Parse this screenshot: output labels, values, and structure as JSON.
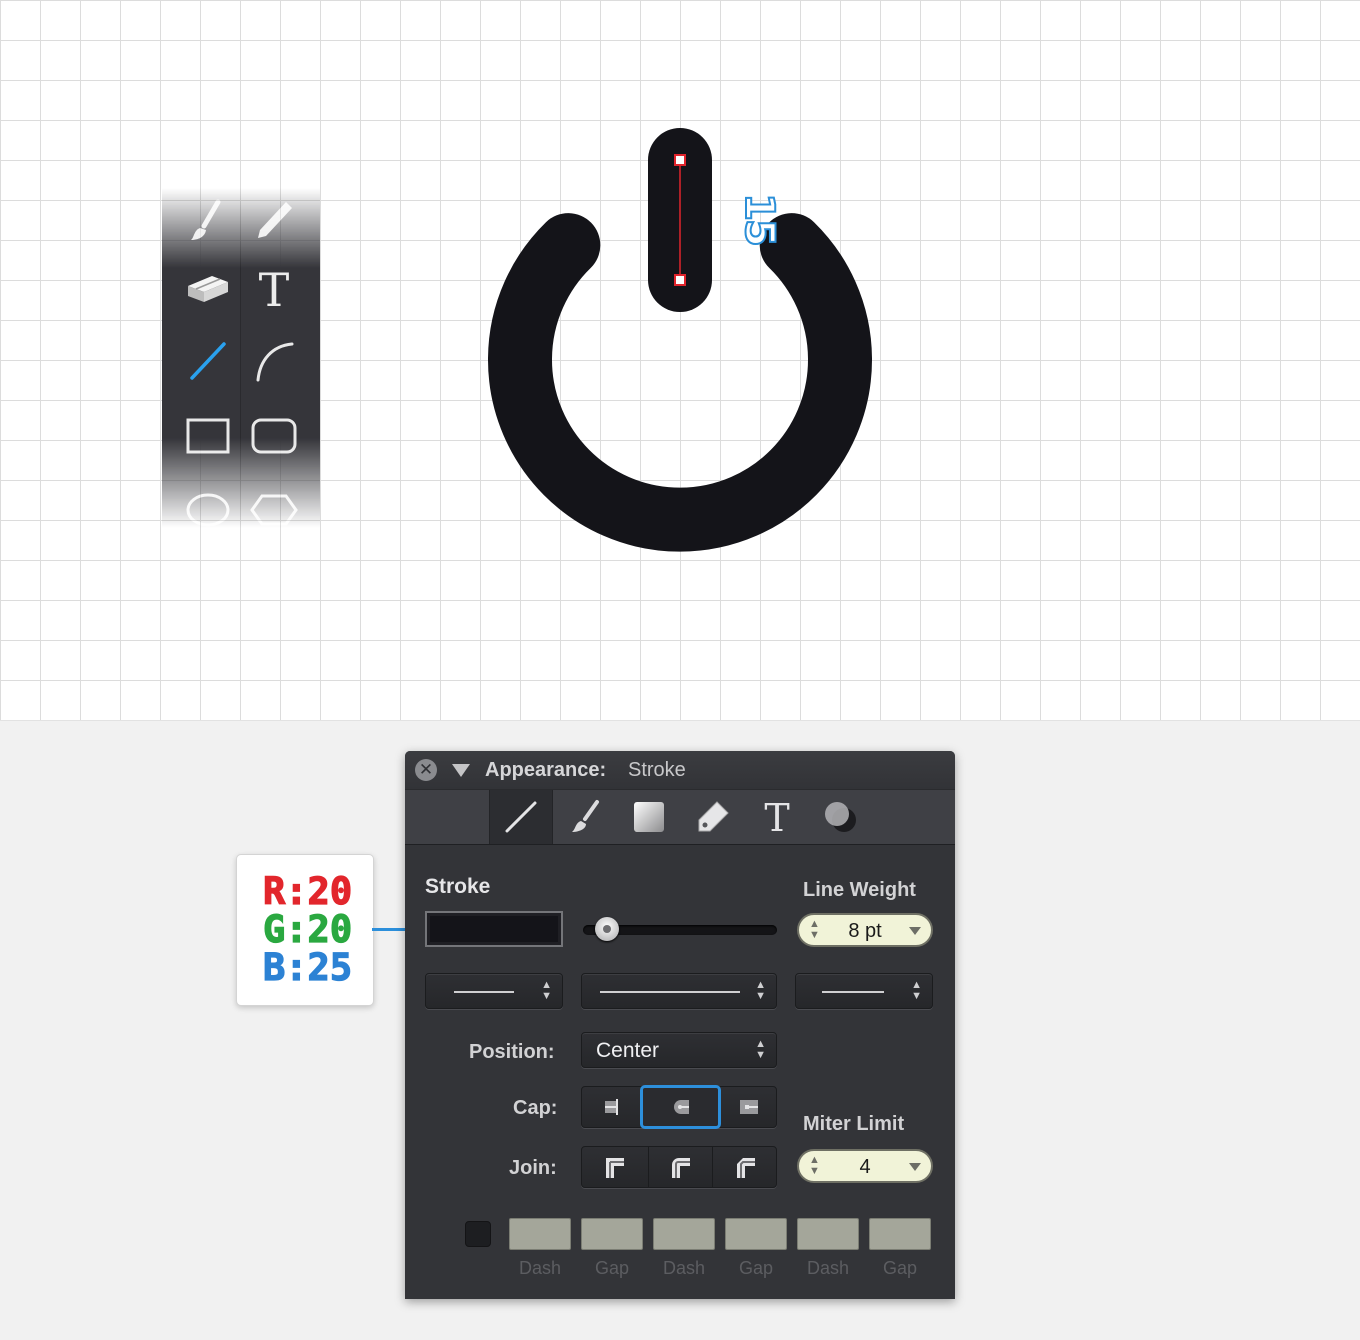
{
  "canvas": {
    "dimension_label": "15",
    "icon_fill": "#141419",
    "selection_color": "#e0242c"
  },
  "toolbox": {
    "tools": [
      "paintbrush-icon",
      "pencil-icon",
      "eraser-icon",
      "text-icon",
      "line-icon",
      "arc-icon",
      "rectangle-icon",
      "rounded-rectangle-icon",
      "ellipse-icon",
      "polygon-icon"
    ],
    "active_tool": "line-icon",
    "text_tool_glyph": "T"
  },
  "rgb_callout": {
    "r": "R:20",
    "g": "G:20",
    "b": "B:25",
    "colors": {
      "r": "#e2262c",
      "g": "#2aa840",
      "b": "#2c82d4"
    }
  },
  "panel": {
    "title_label": "Appearance:",
    "title_value": "Stroke",
    "tabs": [
      "stroke-icon",
      "brush-icon",
      "fill-icon",
      "tag-icon",
      "text-icon",
      "shadow-icon"
    ],
    "active_tab": "stroke-icon",
    "text_tab_glyph": "T",
    "stroke_label": "Stroke",
    "stroke_color": "#141419",
    "line_weight_label": "Line Weight",
    "line_weight_value": "8 pt",
    "position_label": "Position:",
    "position_value": "Center",
    "cap_label": "Cap:",
    "cap_options": [
      "butt-cap-icon",
      "round-cap-icon",
      "square-cap-icon"
    ],
    "cap_selected": "round-cap-icon",
    "join_label": "Join:",
    "join_options": [
      "miter-join-icon",
      "round-join-icon",
      "bevel-join-icon"
    ],
    "miter_limit_label": "Miter Limit",
    "miter_limit_value": "4",
    "dash_labels": [
      "Dash",
      "Gap",
      "Dash",
      "Gap",
      "Dash",
      "Gap"
    ],
    "up_down_glyph": "▲▼",
    "close_glyph": "✕"
  }
}
